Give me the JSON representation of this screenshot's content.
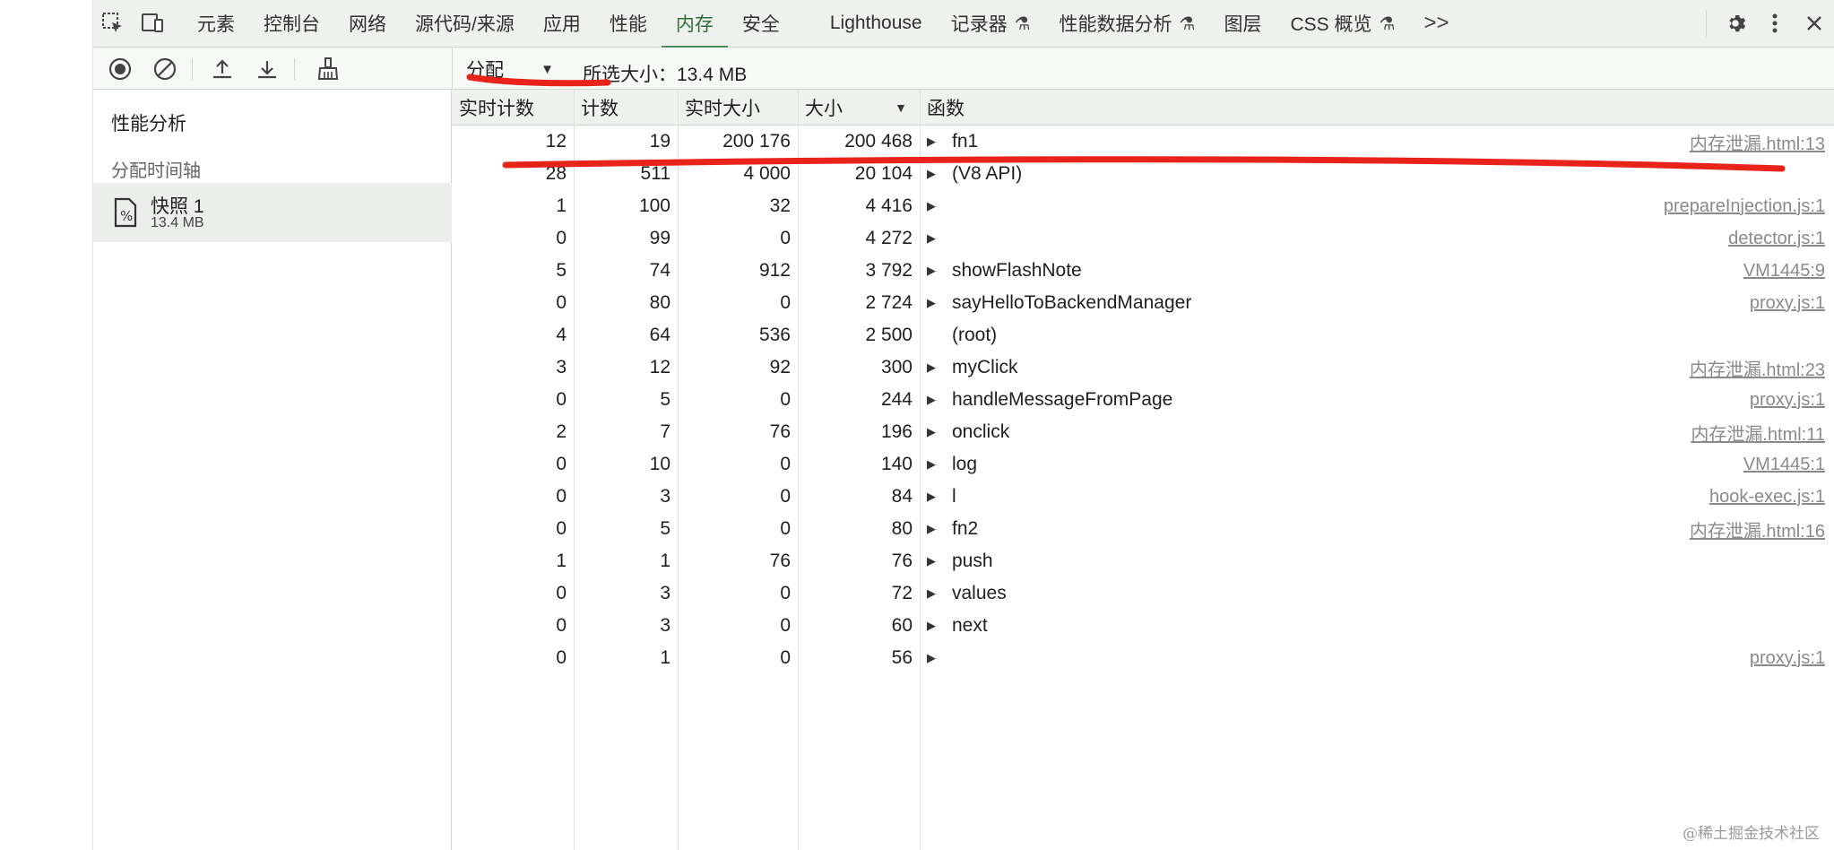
{
  "tabs": {
    "items": [
      "元素",
      "控制台",
      "网络",
      "源代码/来源",
      "应用",
      "性能",
      "内存",
      "安全"
    ],
    "active_index": 6,
    "lighthouse": "Lighthouse",
    "recorder": "记录器",
    "perf_insights": "性能数据分析",
    "layers": "图层",
    "css_overview": "CSS 概览",
    "more": ">>"
  },
  "toolbar": {
    "view": "分配",
    "selected_size": "所选大小：13.4 MB"
  },
  "sidebar": {
    "title": "性能分析",
    "section": "分配时间轴",
    "snapshot_name": "快照 1",
    "snapshot_size": "13.4 MB"
  },
  "table": {
    "headers": [
      "实时计数",
      "计数",
      "实时大小",
      "大小",
      "函数"
    ],
    "rows": [
      {
        "live_count": "12",
        "count": "19",
        "live_size": "200 176",
        "size": "200 468",
        "expand": true,
        "fn": "fn1",
        "src": "内存泄漏.html:13"
      },
      {
        "live_count": "28",
        "count": "511",
        "live_size": "4 000",
        "size": "20 104",
        "expand": true,
        "fn": "(V8 API)",
        "src": ""
      },
      {
        "live_count": "1",
        "count": "100",
        "live_size": "32",
        "size": "4 416",
        "expand": true,
        "fn": "",
        "src": "prepareInjection.js:1"
      },
      {
        "live_count": "0",
        "count": "99",
        "live_size": "0",
        "size": "4 272",
        "expand": true,
        "fn": "",
        "src": "detector.js:1"
      },
      {
        "live_count": "5",
        "count": "74",
        "live_size": "912",
        "size": "3 792",
        "expand": true,
        "fn": "showFlashNote",
        "src": "VM1445:9"
      },
      {
        "live_count": "0",
        "count": "80",
        "live_size": "0",
        "size": "2 724",
        "expand": true,
        "fn": "sayHelloToBackendManager",
        "src": "proxy.js:1"
      },
      {
        "live_count": "4",
        "count": "64",
        "live_size": "536",
        "size": "2 500",
        "expand": false,
        "fn": "(root)",
        "src": ""
      },
      {
        "live_count": "3",
        "count": "12",
        "live_size": "92",
        "size": "300",
        "expand": true,
        "fn": "myClick",
        "src": "内存泄漏.html:23"
      },
      {
        "live_count": "0",
        "count": "5",
        "live_size": "0",
        "size": "244",
        "expand": true,
        "fn": "handleMessageFromPage",
        "src": "proxy.js:1"
      },
      {
        "live_count": "2",
        "count": "7",
        "live_size": "76",
        "size": "196",
        "expand": true,
        "fn": "onclick",
        "src": "内存泄漏.html:11"
      },
      {
        "live_count": "0",
        "count": "10",
        "live_size": "0",
        "size": "140",
        "expand": true,
        "fn": "log",
        "src": "VM1445:1"
      },
      {
        "live_count": "0",
        "count": "3",
        "live_size": "0",
        "size": "84",
        "expand": true,
        "fn": "l",
        "src": "hook-exec.js:1"
      },
      {
        "live_count": "0",
        "count": "5",
        "live_size": "0",
        "size": "80",
        "expand": true,
        "fn": "fn2",
        "src": "内存泄漏.html:16"
      },
      {
        "live_count": "1",
        "count": "1",
        "live_size": "76",
        "size": "76",
        "expand": true,
        "fn": "push",
        "src": ""
      },
      {
        "live_count": "0",
        "count": "3",
        "live_size": "0",
        "size": "72",
        "expand": true,
        "fn": "values",
        "src": ""
      },
      {
        "live_count": "0",
        "count": "3",
        "live_size": "0",
        "size": "60",
        "expand": true,
        "fn": "next",
        "src": ""
      },
      {
        "live_count": "0",
        "count": "1",
        "live_size": "0",
        "size": "56",
        "expand": true,
        "fn": "",
        "src": "proxy.js:1"
      }
    ]
  },
  "colors": {
    "active_tab": "#2f6d3a",
    "annotation": "#e8231a",
    "link": "#8a8a8a"
  },
  "watermark": "@稀土掘金技术社区"
}
